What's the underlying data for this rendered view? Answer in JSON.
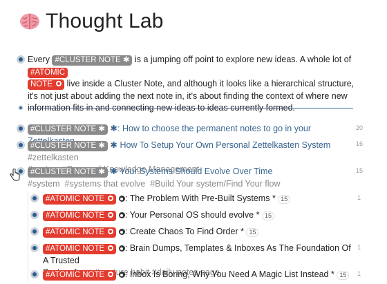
{
  "page": {
    "title": "Thought Lab",
    "title_icon": "brain-icon"
  },
  "intro": {
    "t1": "Every",
    "tag_cluster": "#CLUSTER NOTE ✱",
    "t2": "is a jumping off point to explore new ideas. A whole lot of",
    "tag_atomic_a": "#ATOMIC",
    "tag_atomic_b": "NOTE",
    "t3": "live inside a Cluster Note, and although it looks like a hierarchical structure, it's not just about adding the next note in, it's about finding the context of where new information fits in and connecting new ideas to ideas currently formed."
  },
  "cluster_items": [
    {
      "tag": "#CLUSTER NOTE ✱",
      "star": "✱",
      "title": ": How to choose the permanent notes to go in your Zettelkasten",
      "tags": [],
      "count": "20"
    },
    {
      "tag": "#CLUSTER NOTE ✱",
      "star": "✱",
      "title": "How To Setup Your Own Personal Zettelkasten System",
      "tags": [
        "#zettelkasten",
        "#system",
        "#Personal Knowledge Management"
      ],
      "count": "16"
    },
    {
      "tag": "#CLUSTER NOTE ✱",
      "star": "✱",
      "title": "Your Systems Should Evolve Over Time",
      "tags": [
        "#system",
        "#systems that evolve",
        "#Build Your system/Find Your flow"
      ],
      "count": "15"
    }
  ],
  "atomic_items": [
    {
      "tag": "#ATOMIC NOTE",
      "title": ": The Problem With Pre-Built Systems",
      "star": "*",
      "ref": "15",
      "count": "1"
    },
    {
      "tag": "#ATOMIC NOTE",
      "title": ": Your Personal OS should evolve",
      "star": "*",
      "ref": "15",
      "count": ""
    },
    {
      "tag": "#ATOMIC NOTE",
      "title": ": Create Chaos To Find Order",
      "star": "*",
      "ref": "15",
      "count": ""
    },
    {
      "tag": "#ATOMIC NOTE",
      "title": ": Brain Dumps, Templates & Inboxes As The Foundation Of A Trusted",
      "title2": "System",
      "star": "*",
      "ref": "15",
      "tags": [
        "#capture habit",
        "#daily notes page"
      ],
      "count": "1"
    },
    {
      "tag": "#ATOMIC NOTE",
      "title": ": Inbox Is Boring, Why You Need A Magic List Instead",
      "star": "*",
      "ref": "15",
      "count": "1"
    }
  ],
  "colors": {
    "accent": "#3a6690",
    "atomic_red": "#e33b2e",
    "cluster_grey": "#8a8a8a"
  }
}
